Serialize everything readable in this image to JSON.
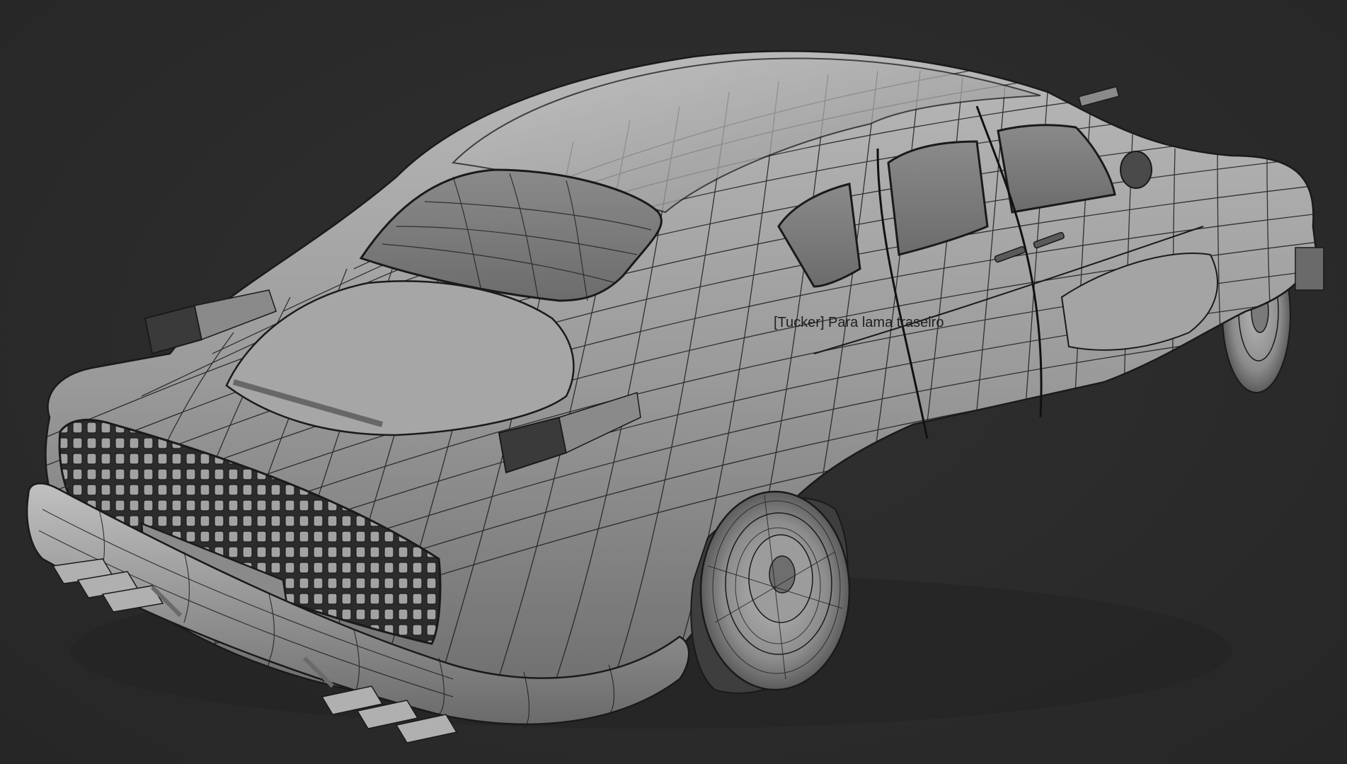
{
  "viewport": {
    "background_color": "#2a2a2a",
    "shading": "grey-shaded-with-wireframe",
    "wire_color": "#1a1a1a",
    "surface_color": "#9a9a9a"
  },
  "selected_object": {
    "label": "[Tucker] Para lama traseiro"
  }
}
